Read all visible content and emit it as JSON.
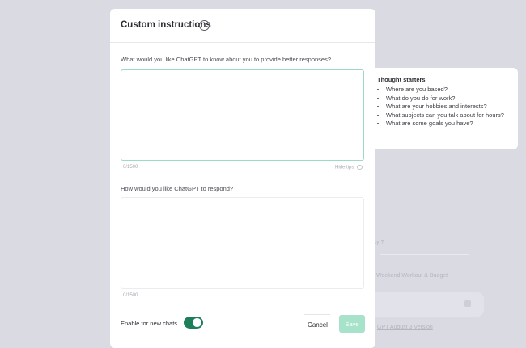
{
  "modal": {
    "title": "Custom instructions",
    "info_icon": "info-icon",
    "q1_label": "What would you like ChatGPT to know about you to provide better responses?",
    "q1_value": "",
    "q1_counter": "0/1500",
    "hide_tips": "Hide tips",
    "hide_tips_icon": "eye-slash-icon",
    "q2_label": "How would you like ChatGPT to respond?",
    "q2_value": "",
    "q2_counter": "0/1500",
    "enable_label": "Enable for new chats",
    "enable_toggle_on": true,
    "cancel_label": "Cancel",
    "save_label": "Save"
  },
  "tips": {
    "title": "Thought starters",
    "items": [
      "Where are you based?",
      "What do you do for work?",
      "What are your hobbies and interests?",
      "What subjects can you talk about for hours?",
      "What are some goals you have?"
    ]
  },
  "background": {
    "item1": "ty ?",
    "item2": "Weekend Workout & Budget",
    "footer": "GPT August 3 Version"
  },
  "colors": {
    "accent": "#1c7f5a",
    "save_disabled": "#a7e2cb",
    "focus_border": "#9ed9c4",
    "overlay": "#d9dae2"
  }
}
